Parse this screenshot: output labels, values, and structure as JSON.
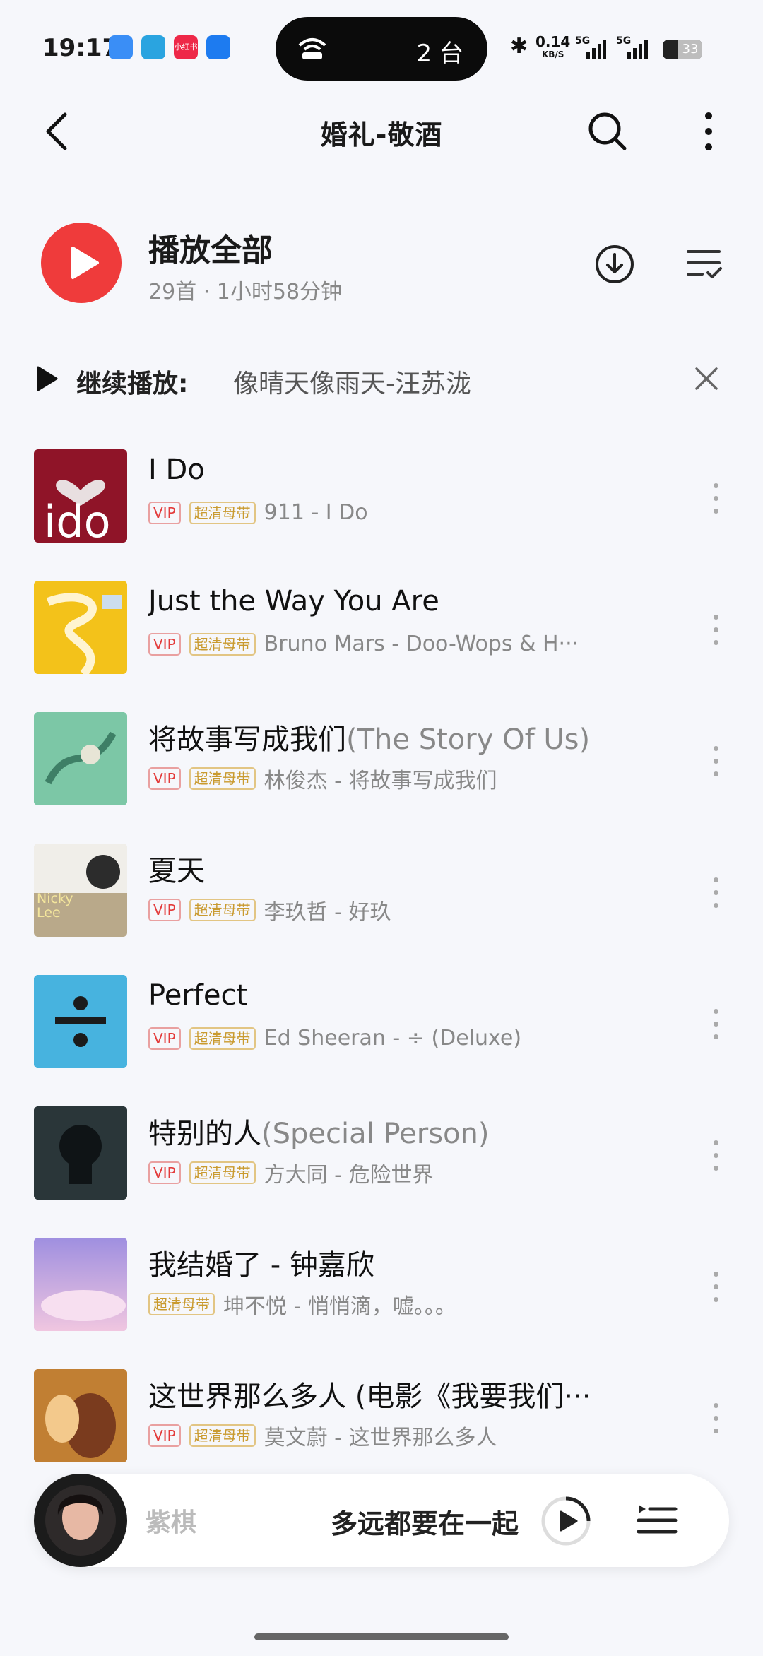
{
  "status_bar": {
    "time": "19:17",
    "island_count": "2 台",
    "net_speed": "0.14",
    "net_unit": "KB/S",
    "signal1": "5G",
    "signal2": "5G",
    "battery": "33",
    "app_icon_red_text": "小红书"
  },
  "header": {
    "title": "婚礼-敬酒",
    "back_icon": "chevron-left-icon",
    "search_icon": "search-icon",
    "more_icon": "more-vertical-icon"
  },
  "play_all": {
    "title": "播放全部",
    "subtitle": "29首 · 1小时58分钟"
  },
  "continue_bar": {
    "label": "继续播放:",
    "song": "像晴天像雨天-汪苏泷"
  },
  "songs": [
    {
      "title": "I Do",
      "subtitle": "",
      "vip": "VIP",
      "quality": "超清母带",
      "meta": "911 - I Do"
    },
    {
      "title": "Just the Way You Are",
      "subtitle": "",
      "vip": "VIP",
      "quality": "超清母带",
      "meta": "Bruno Mars - Doo-Wops & H···"
    },
    {
      "title": "将故事写成我们",
      "subtitle": "(The Story Of Us)",
      "vip": "VIP",
      "quality": "超清母带",
      "meta": "林俊杰 - 将故事写成我们"
    },
    {
      "title": "夏天",
      "subtitle": "",
      "vip": "VIP",
      "quality": "超清母带",
      "meta": "李玖哲 - 好玖",
      "cover_text": "Nicky Lee"
    },
    {
      "title": "Perfect",
      "subtitle": "",
      "vip": "VIP",
      "quality": "超清母带",
      "meta": "Ed Sheeran - ÷ (Deluxe)"
    },
    {
      "title": "特别的人",
      "subtitle": "(Special Person)",
      "vip": "VIP",
      "quality": "超清母带",
      "meta": "方大同 - 危险世界"
    },
    {
      "title": "我结婚了 - 钟嘉欣",
      "subtitle": "",
      "vip": "",
      "quality": "超清母带",
      "meta": "坤不悦 - 悄悄滴，嘘。。。"
    },
    {
      "title": "这世界那么多人 (电影《我要我们···",
      "subtitle": "",
      "vip": "VIP",
      "quality": "超清母带",
      "meta": "莫文蔚 - 这世界那么多人"
    }
  ],
  "mini_player": {
    "artist": "紫棋",
    "title": "多远都要在一起"
  }
}
